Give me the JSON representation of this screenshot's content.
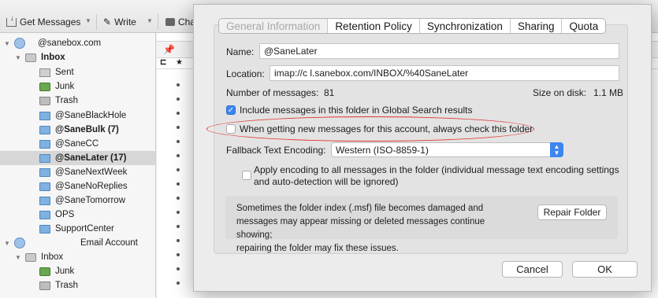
{
  "toolbar": {
    "get_messages": "Get Messages",
    "write": "Write",
    "chat": "Cha"
  },
  "folders": [
    {
      "label": "@sanebox.com",
      "type": "account",
      "bold": false,
      "selected": false
    },
    {
      "label": "Inbox",
      "type": "inbox",
      "bold": true,
      "selected": false
    },
    {
      "label": "Sent",
      "type": "send",
      "bold": false,
      "selected": false
    },
    {
      "label": "Junk",
      "type": "junk",
      "bold": false,
      "selected": false
    },
    {
      "label": "Trash",
      "type": "trash",
      "bold": false,
      "selected": false
    },
    {
      "label": "@SaneBlackHole",
      "type": "folder",
      "bold": false,
      "selected": false
    },
    {
      "label": "@SaneBulk (7)",
      "type": "folder",
      "bold": true,
      "selected": false
    },
    {
      "label": "@SaneCC",
      "type": "folder",
      "bold": false,
      "selected": false
    },
    {
      "label": "@SaneLater (17)",
      "type": "folder",
      "bold": true,
      "selected": true
    },
    {
      "label": "@SaneNextWeek",
      "type": "folder",
      "bold": false,
      "selected": false
    },
    {
      "label": "@SaneNoReplies",
      "type": "folder",
      "bold": false,
      "selected": false
    },
    {
      "label": "@SaneTomorrow",
      "type": "folder",
      "bold": false,
      "selected": false
    },
    {
      "label": "OPS",
      "type": "folder",
      "bold": false,
      "selected": false
    },
    {
      "label": "SupportCenter",
      "type": "folder",
      "bold": false,
      "selected": false
    },
    {
      "label": "Email Account",
      "type": "account",
      "bold": false,
      "selected": false
    },
    {
      "label": "Inbox",
      "type": "inbox",
      "bold": false,
      "selected": false
    },
    {
      "label": "Junk",
      "type": "junk",
      "bold": false,
      "selected": false
    },
    {
      "label": "Trash",
      "type": "trash",
      "bold": false,
      "selected": false
    }
  ],
  "dialog": {
    "tabs": [
      {
        "label": "General Information",
        "active": true
      },
      {
        "label": "Retention Policy",
        "active": false
      },
      {
        "label": "Synchronization",
        "active": false
      },
      {
        "label": "Sharing",
        "active": false
      },
      {
        "label": "Quota",
        "active": false
      }
    ],
    "name_label": "Name:",
    "name_value": "@SaneLater",
    "location_label": "Location:",
    "location_value": "imap://c            l.sanebox.com/INBOX/%40SaneLater",
    "messages_label": "Number of messages:",
    "messages_value": "81",
    "size_label": "Size on disk:",
    "size_value": "1.1 MB",
    "global_search_label": "Include messages in this folder in Global Search results",
    "global_search_checked": true,
    "always_check_label": "When getting new messages for this account, always check this folder",
    "always_check_checked": false,
    "fallback_label": "Fallback Text Encoding:",
    "fallback_value": "Western (ISO-8859-1)",
    "apply_encoding_label_1": "Apply encoding to all messages in the folder (individual message text encoding settings",
    "apply_encoding_label_2": "and auto-detection will be ignored)",
    "apply_encoding_checked": false,
    "repair_text_1": "Sometimes the folder index (.msf) file becomes damaged and",
    "repair_text_2": "messages may appear missing or deleted messages continue showing;",
    "repair_text_3": "repairing the folder may fix these issues.",
    "repair_button": "Repair Folder",
    "cancel_button": "Cancel",
    "ok_button": "OK"
  },
  "colors": {
    "accent": "#3b86f0",
    "highlight_ellipse": "#e0342e"
  }
}
